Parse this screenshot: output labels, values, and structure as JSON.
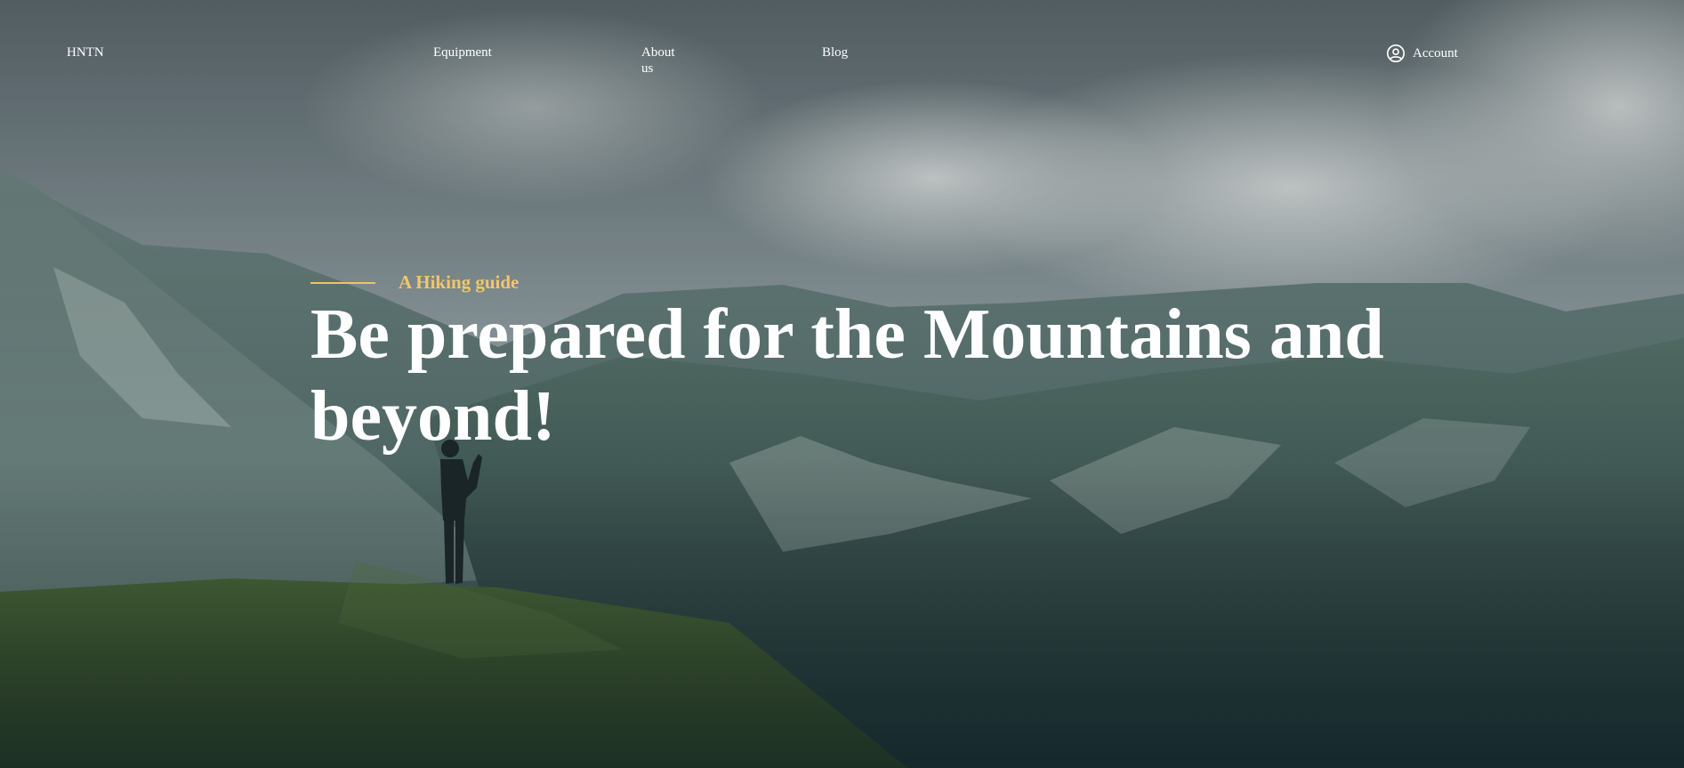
{
  "header": {
    "logo": "HNTN",
    "nav": {
      "equipment": "Equipment",
      "about": "About us",
      "blog": "Blog"
    },
    "account_label": "Account"
  },
  "hero": {
    "eyebrow": "A Hiking guide",
    "headline": "Be prepared for the Mountains and beyond!"
  },
  "colors": {
    "accent": "#e9c46a",
    "text": "#ffffff"
  },
  "icons": {
    "account": "user-circle-icon"
  }
}
